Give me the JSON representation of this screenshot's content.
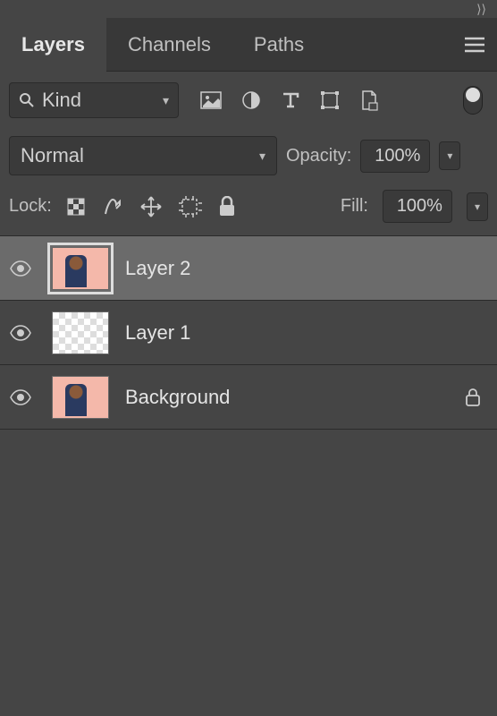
{
  "tabs": {
    "layers": "Layers",
    "channels": "Channels",
    "paths": "Paths"
  },
  "filter": {
    "kind_label": "Kind"
  },
  "blend": {
    "mode": "Normal",
    "opacity_label": "Opacity:",
    "opacity_value": "100%"
  },
  "lock": {
    "label": "Lock:",
    "fill_label": "Fill:",
    "fill_value": "100%"
  },
  "layers": [
    {
      "name": "Layer 2",
      "thumb": "photo",
      "selected": true,
      "locked": false,
      "visible": true
    },
    {
      "name": "Layer 1",
      "thumb": "checker",
      "selected": false,
      "locked": false,
      "visible": true
    },
    {
      "name": "Background",
      "thumb": "photo",
      "selected": false,
      "locked": true,
      "visible": true
    }
  ]
}
